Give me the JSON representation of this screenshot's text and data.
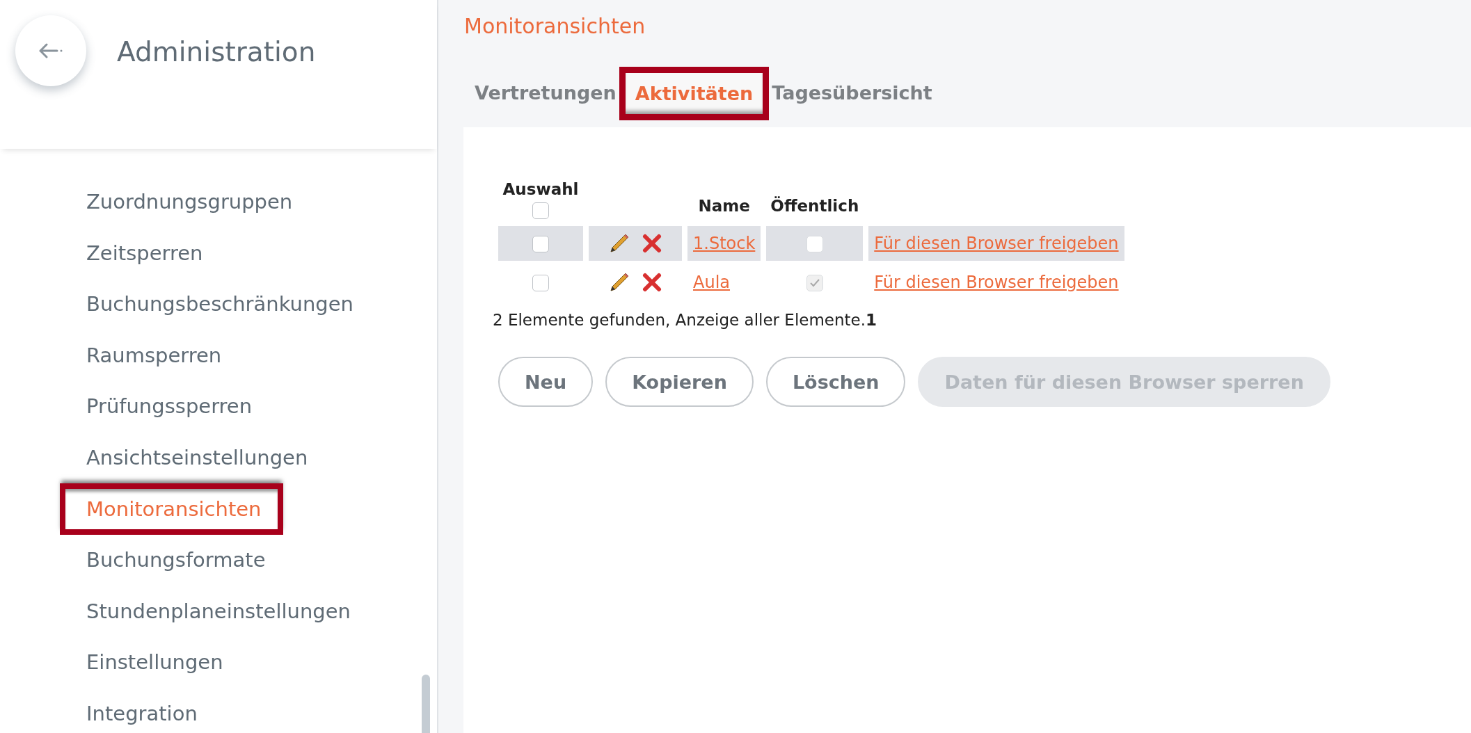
{
  "sidebar": {
    "title": "Administration",
    "items": [
      {
        "label": "Zuordnungsgruppen",
        "selected": false,
        "highlighted": false
      },
      {
        "label": "Zeitsperren",
        "selected": false,
        "highlighted": false
      },
      {
        "label": "Buchungsbeschränkungen",
        "selected": false,
        "highlighted": false
      },
      {
        "label": "Raumsperren",
        "selected": false,
        "highlighted": false
      },
      {
        "label": "Prüfungssperren",
        "selected": false,
        "highlighted": false
      },
      {
        "label": "Ansichtseinstellungen",
        "selected": false,
        "highlighted": false
      },
      {
        "label": "Monitoransichten",
        "selected": true,
        "highlighted": true
      },
      {
        "label": "Buchungsformate",
        "selected": false,
        "highlighted": false
      },
      {
        "label": "Stundenplaneinstellungen",
        "selected": false,
        "highlighted": false
      },
      {
        "label": "Einstellungen",
        "selected": false,
        "highlighted": false
      },
      {
        "label": "Integration",
        "selected": false,
        "highlighted": false
      }
    ]
  },
  "page_title": "Monitoransichten",
  "tabs": [
    {
      "label": "Vertretungen",
      "selected": false,
      "highlighted": false
    },
    {
      "label": "Aktivitäten",
      "selected": true,
      "highlighted": true
    },
    {
      "label": "Tagesübersicht",
      "selected": false,
      "highlighted": false
    }
  ],
  "table": {
    "columns": [
      "Auswahl",
      "Name",
      "Öffentlich"
    ],
    "select_all_checked": false,
    "rows": [
      {
        "checked": false,
        "name": "1.Stock",
        "public": false,
        "link": "Für diesen Browser freigeben",
        "shaded": true
      },
      {
        "checked": false,
        "name": "Aula",
        "public": true,
        "link": "Für diesen Browser freigeben",
        "shaded": false
      }
    ],
    "summary": "2 Elemente gefunden, Anzeige aller Elemente.**1**"
  },
  "buttons": [
    {
      "label": "Neu",
      "disabled": false
    },
    {
      "label": "Kopieren",
      "disabled": false
    },
    {
      "label": "Löschen",
      "disabled": false
    },
    {
      "label": "Daten für diesen Browser sperren",
      "disabled": true
    }
  ]
}
